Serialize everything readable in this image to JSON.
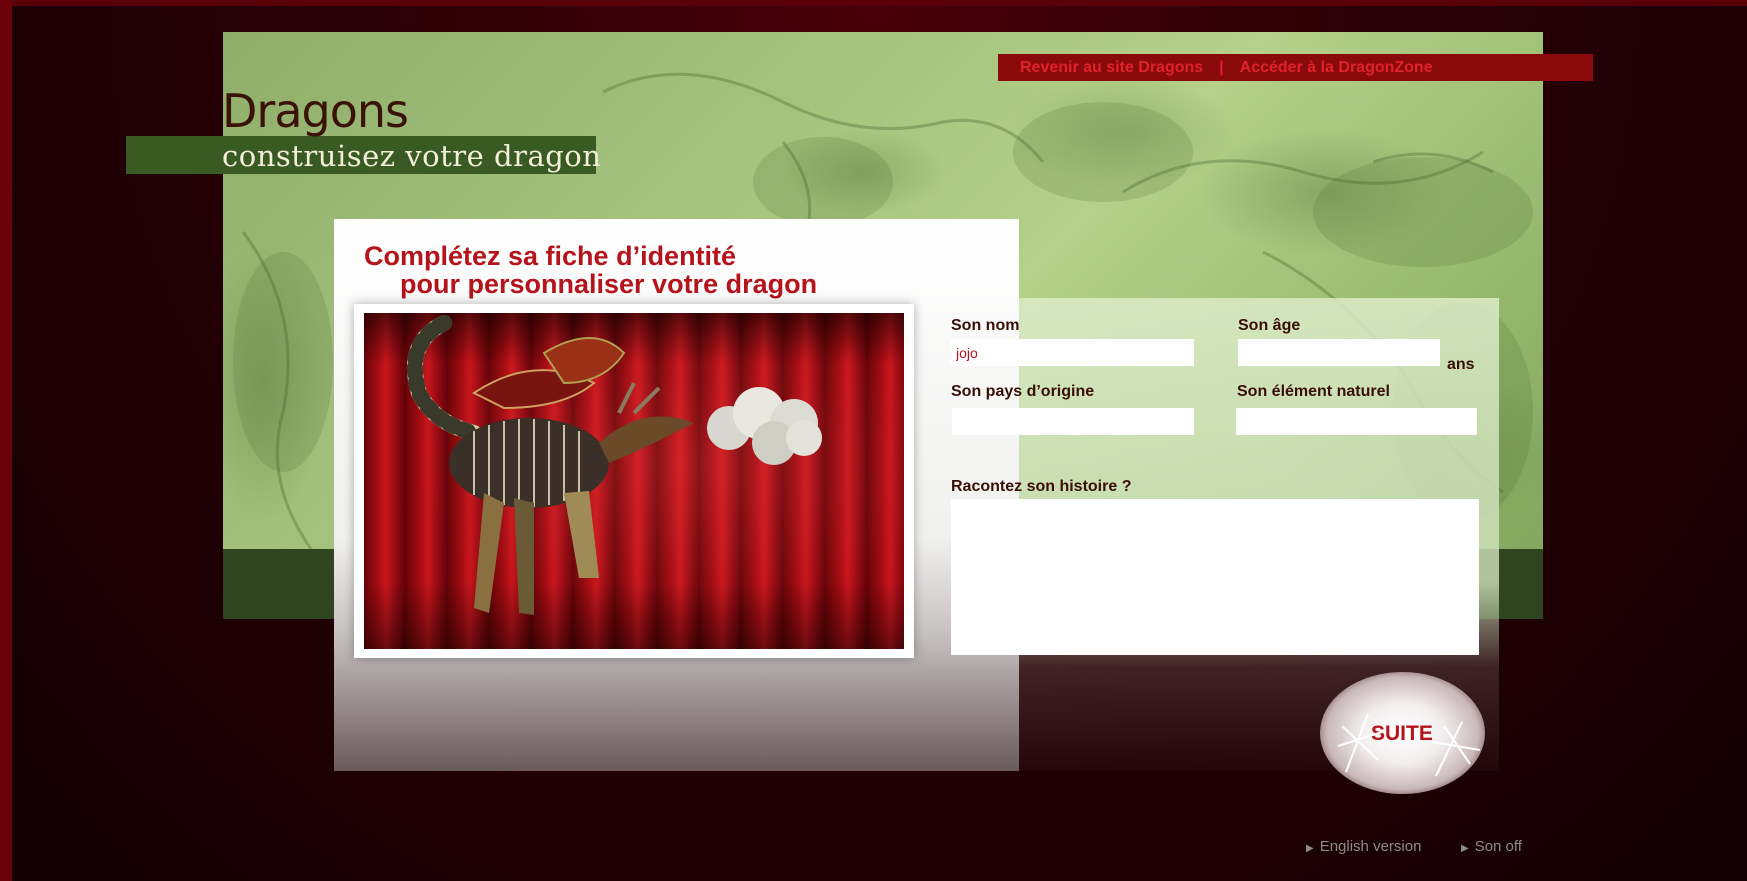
{
  "site": {
    "brand_title": "Dragons",
    "brand_subtitle": "construisez votre dragon"
  },
  "top_nav": {
    "links": [
      {
        "label": "Revenir au site Dragons"
      },
      {
        "label": "Accéder à la DragonZone"
      }
    ],
    "separator": "|"
  },
  "form": {
    "heading_line1": "Complétez sa fiche d’identité",
    "heading_line2": "pour personnaliser votre dragon",
    "fields": {
      "name": {
        "label": "Son nom",
        "value": "jojo"
      },
      "age": {
        "label": "Son âge",
        "value": "",
        "unit": "ans"
      },
      "country": {
        "label": "Son pays d’origine",
        "value": ""
      },
      "element": {
        "label": "Son élément naturel",
        "value": ""
      },
      "story": {
        "label": "Racontez son histoire ?",
        "value": ""
      }
    },
    "submit_label": "SUITE"
  },
  "footer": {
    "links": [
      {
        "label": "English version",
        "icon": "triangle-right-icon"
      },
      {
        "label": "Son off",
        "icon": "triangle-right-icon"
      }
    ]
  },
  "colors": {
    "accent_red": "#b5141c",
    "top_bar": "#8a0a0c",
    "green_panel": "#a6c47e",
    "dark_background": "#2a0006"
  }
}
